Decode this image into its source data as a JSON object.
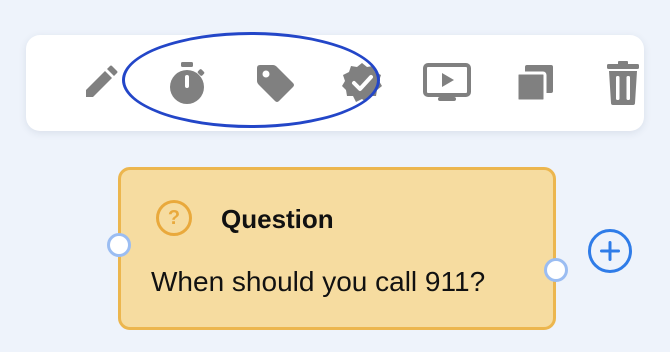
{
  "toolbar": {
    "tools": [
      {
        "name": "edit",
        "icon": "pencil-icon"
      },
      {
        "name": "timer",
        "icon": "stopwatch-icon"
      },
      {
        "name": "tag",
        "icon": "tag-icon"
      },
      {
        "name": "verified",
        "icon": "verified-badge-icon"
      },
      {
        "name": "preview",
        "icon": "play-screen-icon"
      },
      {
        "name": "duplicate",
        "icon": "copy-icon"
      },
      {
        "name": "delete",
        "icon": "trash-icon"
      }
    ],
    "icon_color": "#808080",
    "highlight_color": "#2346c8"
  },
  "node": {
    "icon_glyph": "?",
    "title": "Question",
    "text": "When should you call 911?",
    "fill_color": "#f6dca0",
    "border_color": "#ecb64e"
  },
  "add_button": {
    "icon": "add-circle-icon",
    "color": "#2f7ce8"
  }
}
